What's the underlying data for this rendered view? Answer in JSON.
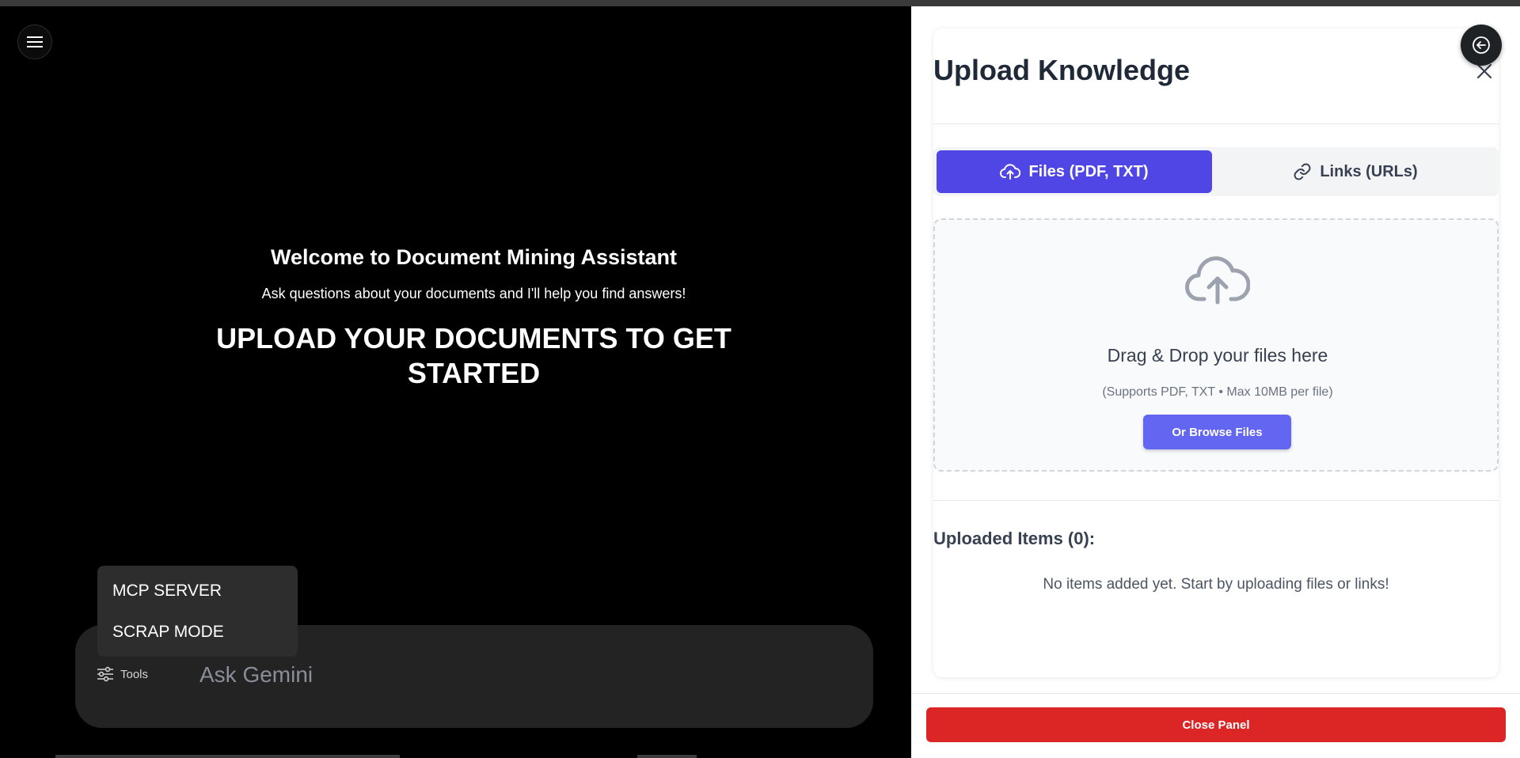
{
  "welcome": {
    "title": "Welcome to Document Mining Assistant",
    "subtitle": "Ask questions about your documents and I'll help you find answers!",
    "headline": "UPLOAD YOUR DOCUMENTS TO GET STARTED"
  },
  "tools_menu": {
    "items": [
      {
        "label": "MCP SERVER"
      },
      {
        "label": "SCRAP MODE"
      }
    ]
  },
  "chat": {
    "tools_label": "Tools",
    "placeholder": "Ask Gemini"
  },
  "panel": {
    "title": "Upload Knowledge",
    "tabs": [
      {
        "label": "Files (PDF, TXT)",
        "active": true
      },
      {
        "label": "Links (URLs)",
        "active": false
      }
    ],
    "dropzone": {
      "title": "Drag & Drop your files here",
      "subtitle": "(Supports PDF, TXT • Max 10MB per file)",
      "browse_label": "Or Browse Files"
    },
    "uploaded_title": "Uploaded Items (0):",
    "empty_text": "No items added yet. Start by uploading files or links!",
    "close_label": "Close Panel"
  },
  "colors": {
    "accent": "#4f46e5",
    "browse": "#6366f1",
    "danger": "#dc2626"
  },
  "icons": {
    "menu": "hamburger-icon",
    "back": "arrow-left-circle-icon",
    "close": "close-icon",
    "upload_tab": "cloud-upload-icon",
    "links_tab": "link-icon",
    "dropzone": "cloud-upload-icon",
    "tools": "sliders-icon"
  }
}
